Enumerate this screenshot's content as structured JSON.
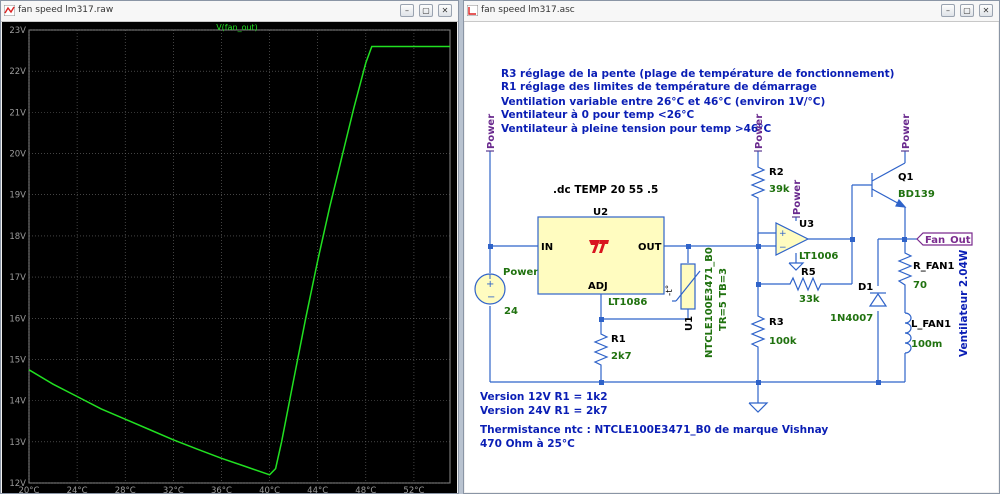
{
  "waveform_window": {
    "title": "fan speed lm317.raw",
    "buttons": [
      "minimize-button",
      "maximize-button",
      "close-button"
    ]
  },
  "schematic_window": {
    "title": "fan speed lm317.asc"
  },
  "chart_data": {
    "type": "line",
    "title": "V(fan_out)",
    "xlabel": "",
    "ylabel": "",
    "x_ticks": [
      "20°C",
      "24°C",
      "28°C",
      "32°C",
      "36°C",
      "40°C",
      "44°C",
      "48°C",
      "52°C"
    ],
    "y_ticks": [
      "12V",
      "13V",
      "14V",
      "15V",
      "16V",
      "17V",
      "18V",
      "19V",
      "20V",
      "21V",
      "22V",
      "23V"
    ],
    "xlim": [
      20,
      55
    ],
    "ylim": [
      12,
      23
    ],
    "grid": true,
    "series": [
      {
        "name": "V(fan_out)",
        "color": "#21e021",
        "x": [
          20,
          22,
          24,
          26,
          28,
          30,
          32,
          34,
          36,
          38,
          40,
          40.5,
          41,
          42,
          43,
          44,
          45,
          46,
          47,
          48,
          48.5,
          49,
          50,
          52,
          55
        ],
        "y": [
          14.75,
          14.4,
          14.1,
          13.8,
          13.55,
          13.3,
          13.05,
          12.82,
          12.6,
          12.4,
          12.2,
          12.35,
          13.0,
          14.5,
          16.0,
          17.4,
          18.7,
          19.9,
          21.1,
          22.2,
          22.6,
          22.6,
          22.6,
          22.6,
          22.6
        ]
      }
    ]
  },
  "schematic": {
    "notes": [
      "R3 réglage de la pente (plage de température de fonctionnement)",
      "R1 réglage des limites de température de démarrage",
      "Ventilation variable entre 26°C et 46°C (environ 1V/°C)",
      "Ventilateur à 0 pour temp <26°C",
      "Ventilateur à pleine tension pour temp >46°C"
    ],
    "directive": ".dc TEMP 20 55 .5",
    "version_notes": [
      "Version 12V R1 = 1k2",
      "Version 24V R1 = 2k7"
    ],
    "thermistor_notes": [
      "Thermistance ntc : NTCLE100E3471_B0 de marque  Vishnay",
      "470 Ohm à 25°C"
    ],
    "fan_power_label": "Ventilateur 2.04W",
    "net_label": "Fan_Out",
    "power_labels": [
      "Power",
      "Power",
      "Power",
      "Power"
    ],
    "source": {
      "name": "Power",
      "value": "24"
    },
    "regulator": {
      "ref": "U2",
      "model": "LT1086",
      "pin_in": "IN",
      "pin_out": "OUT",
      "pin_adj": "ADJ"
    },
    "thermistor": {
      "ref": "U1",
      "model": "NTCLE100E3471_B0",
      "params": "TR=5 TB=3",
      "symbol": "-t°"
    },
    "opamp": {
      "ref": "U3",
      "model": "LT1006"
    },
    "r1": {
      "ref": "R1",
      "value": "2k7"
    },
    "r2": {
      "ref": "R2",
      "value": "39k"
    },
    "r3": {
      "ref": "R3",
      "value": "100k"
    },
    "r5": {
      "ref": "R5",
      "value": "33k"
    },
    "d1": {
      "ref": "D1",
      "model": "1N4007"
    },
    "q1": {
      "ref": "Q1",
      "model": "BD139"
    },
    "r_fan": {
      "ref": "R_FAN1",
      "value": "70"
    },
    "l_fan": {
      "ref": "L_FAN1",
      "value": "100m"
    },
    "colors": {
      "wire": "#2f63c9",
      "note": "#0a1eb5",
      "comp_text": "#20720f",
      "power": "#6a2a8e",
      "net": "#7a2a8e"
    }
  }
}
